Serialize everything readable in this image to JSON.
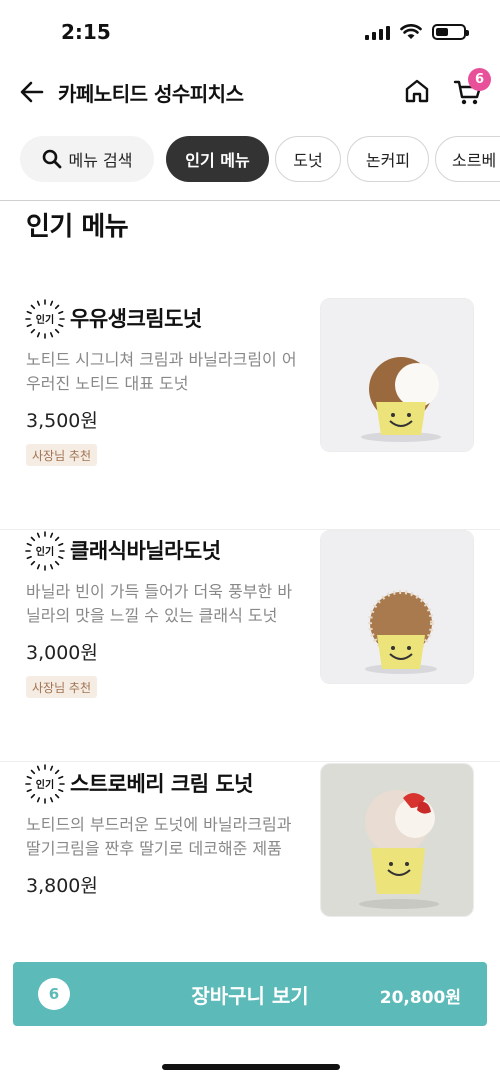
{
  "status_bar": {
    "time": "2:15",
    "battery_level": 0.45
  },
  "header": {
    "title": "카페노티드 성수피치스",
    "back_icon": "arrow-left-icon",
    "home_icon": "home-icon",
    "cart_icon": "cart-icon",
    "cart_badge": "6",
    "badge_color": "#e8509a"
  },
  "chips": {
    "search_label": "메뉴 검색",
    "items": [
      "인기 메뉴",
      "도넛",
      "논커피",
      "소르베"
    ]
  },
  "section_title": "인기 메뉴",
  "popular_badge": "인기",
  "menu_items": [
    {
      "name": "우유생크림도넛",
      "desc": "노티드 시그니쳐 크림과 바닐라크림이 어우러진 노티드 대표 도넛",
      "price": "3,500원",
      "tag": "사장님 추천"
    },
    {
      "name": "클래식바닐라도넛",
      "desc": "바닐라 빈이 가득 들어가 더욱 풍부한 바닐라의 맛을 느낄 수 있는 클래식 도넛",
      "price": "3,000원",
      "tag": "사장님 추천"
    },
    {
      "name": "스트로베리 크림 도넛",
      "desc": "노티드의 부드러운 도넛에 바닐라크림과 딸기크림을 짠후 딸기로 데코해준 제품",
      "price": "3,800원",
      "tag": ""
    }
  ],
  "cart_bar": {
    "count": "6",
    "label": "장바구니 보기",
    "total": "20,800원",
    "color": "#5cbab8"
  }
}
